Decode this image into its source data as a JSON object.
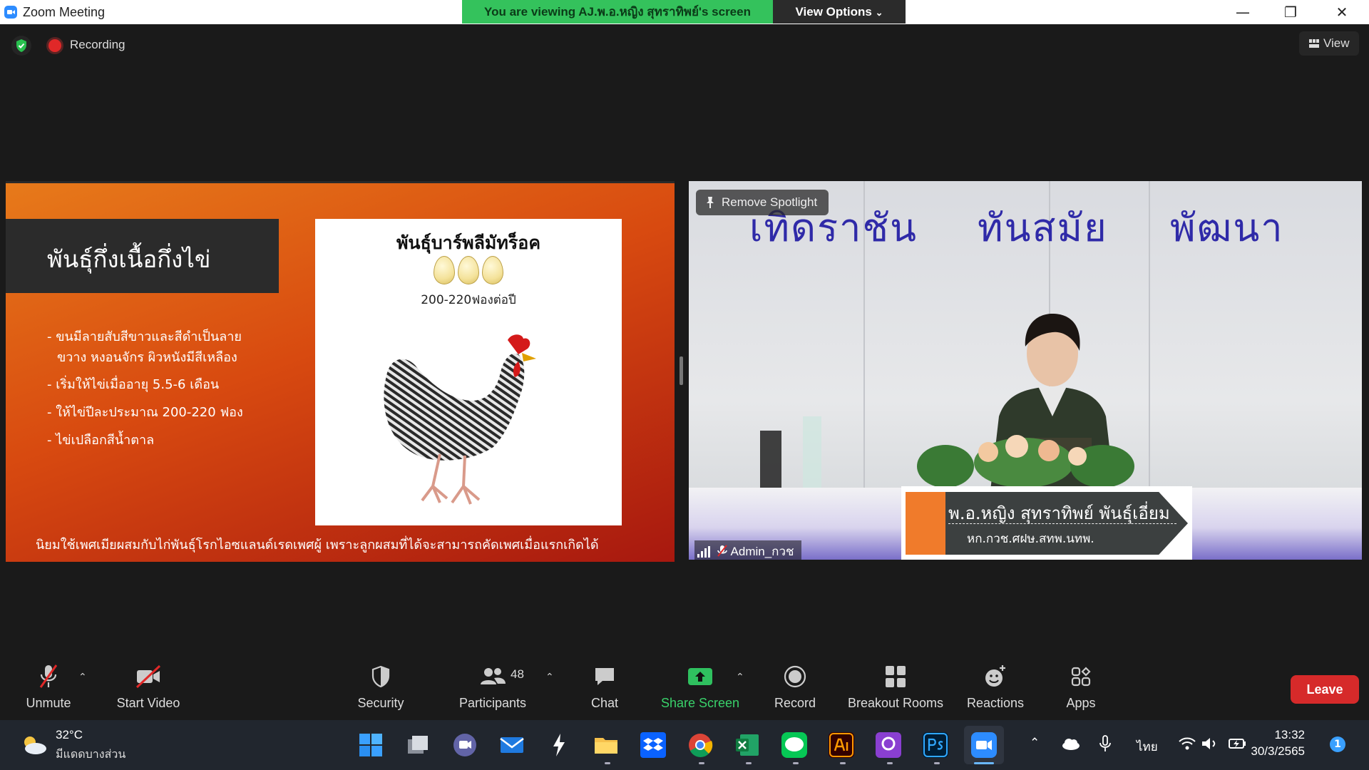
{
  "window": {
    "title": "Zoom Meeting",
    "viewing_banner": "You are viewing AJ.พ.อ.หญิง สุทราทิพย์'s screen",
    "view_options_label": "View Options"
  },
  "topbar": {
    "recording_label": "Recording",
    "view_label": "View"
  },
  "slide": {
    "title": "พันธุ์กึ่งเนื้อกึ่งไข่",
    "bullets": [
      "- ขนมีลายสับสีขาวและสีดำเป็นลาย",
      "ขวาง หงอนจักร ผิวหนังมีสีเหลือง",
      "- เริ่มให้ไข่เมื่ออายุ 5.5-6 เดือน",
      "- ให้ไข่ปีละประมาณ 200-220 ฟอง",
      "- ไข่เปลือกสีน้ำตาล"
    ],
    "card_title": "พันธุ์บาร์พลีมัทร็อค",
    "card_subtitle": "200-220ฟองต่อปี",
    "footer": "นิยมใช้เพศเมียผสมกับไก่พันธุ์โรกไอซแลนด์เรดเพศผู้ เพราะลูกผสมที่ได้จะสามารถคัดเพศเมื่อแรกเกิดได้"
  },
  "video": {
    "remove_spotlight_label": "Remove Spotlight",
    "banner_words": [
      "เทิดราชัน",
      "ทันสมัย",
      "พัฒนา"
    ],
    "participant_name": "Admin_กวช",
    "caption_line1": "พ.อ.หญิง สุทราทิพย์  พันธุ์เอี่ยม",
    "caption_line2": "หก.กวช.ศฝษ.สทพ.นทพ."
  },
  "toolbar": {
    "unmute": "Unmute",
    "start_video": "Start Video",
    "security": "Security",
    "participants": "Participants",
    "participants_count": "48",
    "chat": "Chat",
    "share_screen": "Share Screen",
    "record": "Record",
    "breakout_rooms": "Breakout Rooms",
    "reactions": "Reactions",
    "apps": "Apps",
    "leave": "Leave"
  },
  "taskbar": {
    "temperature": "32°C",
    "weather": "มีแดดบางส่วน",
    "language": "ไทย",
    "time": "13:32",
    "date": "30/3/2565",
    "notifications": "1"
  },
  "colors": {
    "zoom_blue": "#2d8cff",
    "banner_green": "#34c25c",
    "leave_red": "#d62a2a",
    "share_green": "#39d16a"
  }
}
